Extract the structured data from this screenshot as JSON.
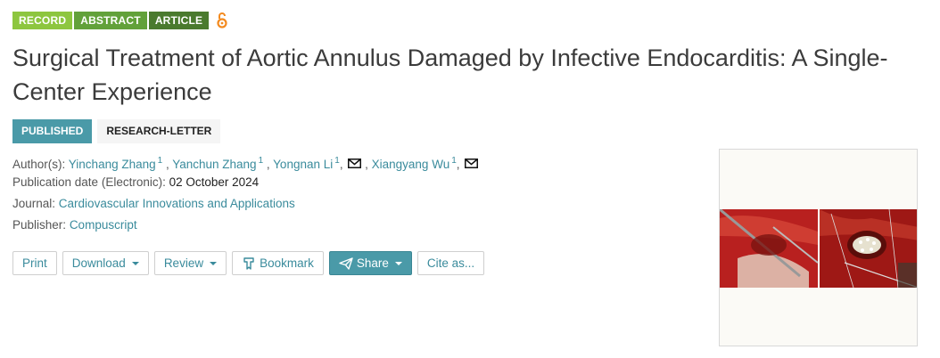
{
  "tags": {
    "record": "RECORD",
    "abstract": "ABSTRACT",
    "article": "ARTICLE",
    "open_access_icon": "open-access-lock-icon"
  },
  "title": "Surgical Treatment of Aortic Annulus Damaged by Infective Endocarditis: A Single-Center Experience",
  "status": {
    "published": "PUBLISHED",
    "type": "RESEARCH-LETTER"
  },
  "meta": {
    "authors_label": "Author(s):",
    "authors": [
      {
        "name": "Yinchang Zhang",
        "sup": "1",
        "mail": false
      },
      {
        "name": "Yanchun Zhang",
        "sup": "1",
        "mail": false
      },
      {
        "name": "Yongnan Li",
        "sup": "1",
        "mail": true
      },
      {
        "name": "Xiangyang Wu",
        "sup": "1",
        "mail": true
      }
    ],
    "pub_date_label": "Publication date (Electronic):",
    "pub_date": "02 October 2024",
    "journal_label": "Journal:",
    "journal": "Cardiovascular Innovations and Applications",
    "publisher_label": "Publisher:",
    "publisher": "Compuscript"
  },
  "toolbar": {
    "print": "Print",
    "download": "Download",
    "review": "Review",
    "bookmark": "Bookmark",
    "share": "Share",
    "cite": "Cite as..."
  },
  "colors": {
    "accent": "#4a9aa8",
    "link": "#3a8b9c",
    "record": "#8dc63f",
    "abstract": "#62a13a",
    "article": "#4a7a2e"
  }
}
